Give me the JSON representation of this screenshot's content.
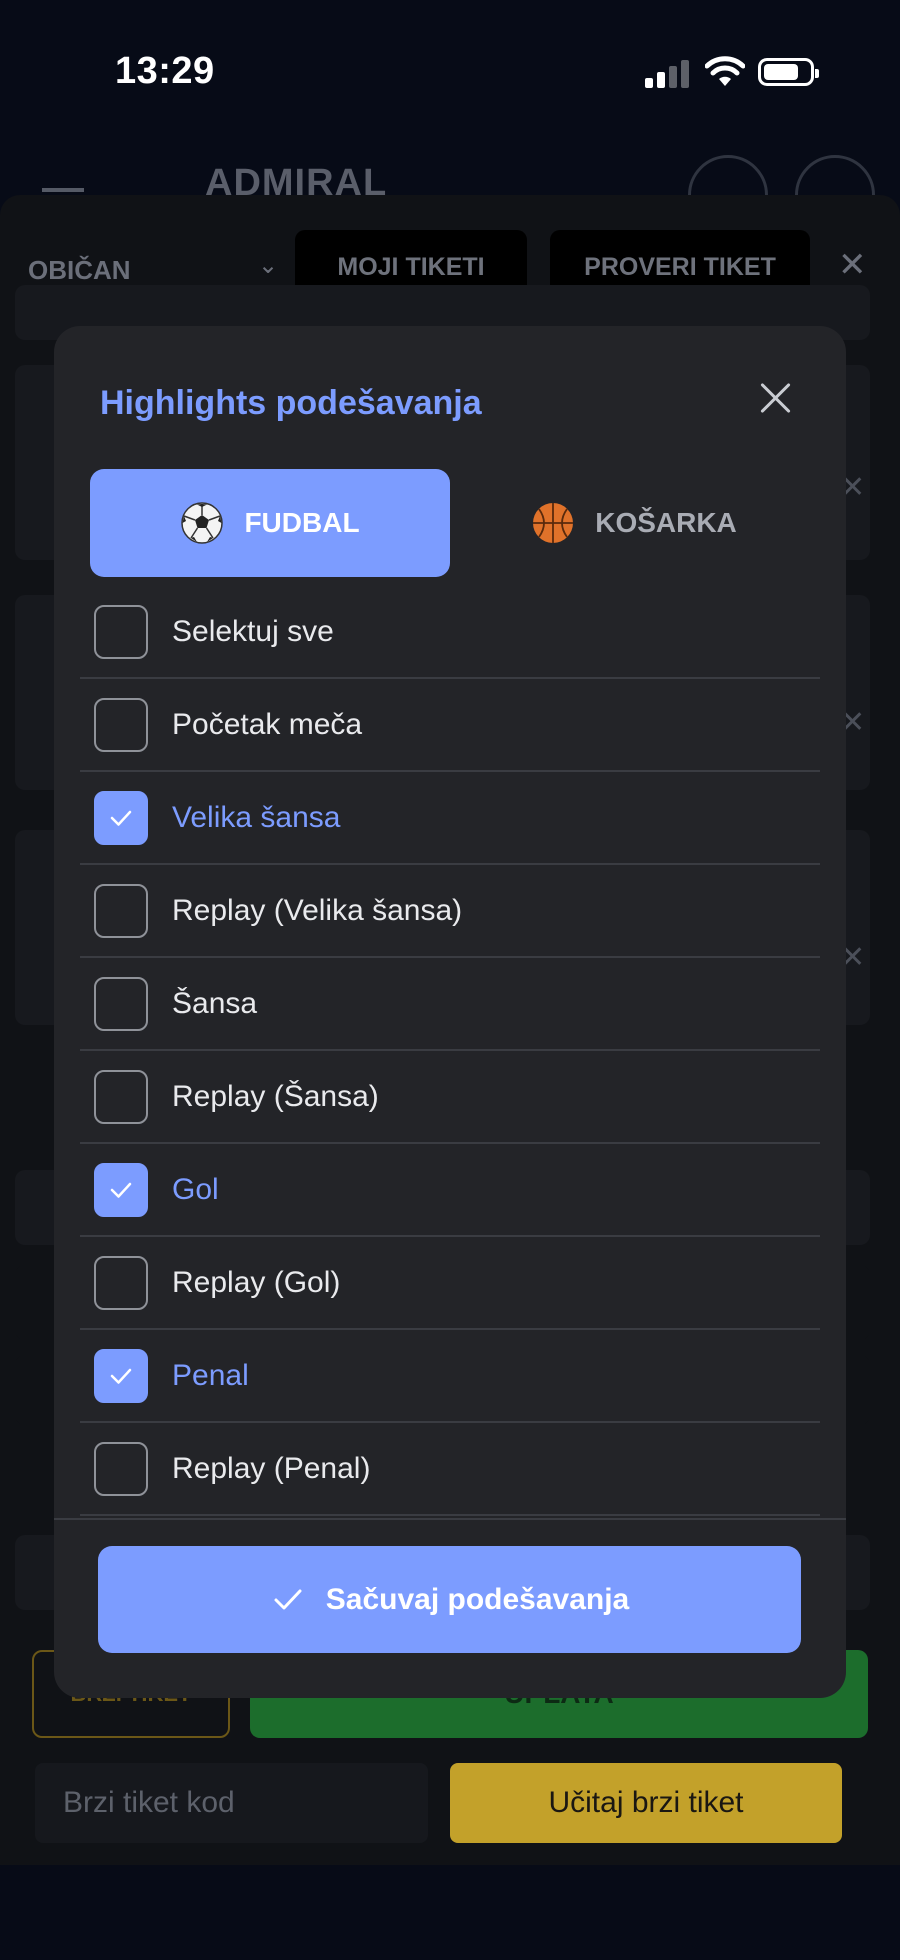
{
  "status_bar": {
    "time": "13:29"
  },
  "header": {
    "logo": "ADMIRAL"
  },
  "ticket_panel": {
    "ticket_type": "OBIČAN",
    "my_tickets_label": "MOJI TIKETI",
    "check_ticket_label": "PROVERI TIKET",
    "fast_ticket_label": "BRZI TIKET",
    "payment_label": "UPLATA",
    "fast_ticket_code_placeholder": "Brzi tiket kod",
    "load_fast_ticket_label": "Učitaj brzi tiket"
  },
  "modal": {
    "title": "Highlights podešavanja",
    "tabs": [
      {
        "label": "FUDBAL",
        "icon": "soccer-ball-icon",
        "active": true
      },
      {
        "label": "KOŠARKA",
        "icon": "basketball-icon",
        "active": false
      }
    ],
    "options": [
      {
        "label": "Selektuj sve",
        "checked": false
      },
      {
        "label": "Početak meča",
        "checked": false
      },
      {
        "label": "Velika šansa",
        "checked": true
      },
      {
        "label": "Replay (Velika šansa)",
        "checked": false
      },
      {
        "label": "Šansa",
        "checked": false
      },
      {
        "label": "Replay (Šansa)",
        "checked": false
      },
      {
        "label": "Gol",
        "checked": true
      },
      {
        "label": "Replay (Gol)",
        "checked": false
      },
      {
        "label": "Penal",
        "checked": true
      },
      {
        "label": "Replay (Penal)",
        "checked": false
      }
    ],
    "save_label": "Sačuvaj podešavanja"
  },
  "colors": {
    "accent": "#7c9cff",
    "modal_bg": "#232428",
    "gold": "#c3a12a",
    "green": "#1c6d2c"
  }
}
